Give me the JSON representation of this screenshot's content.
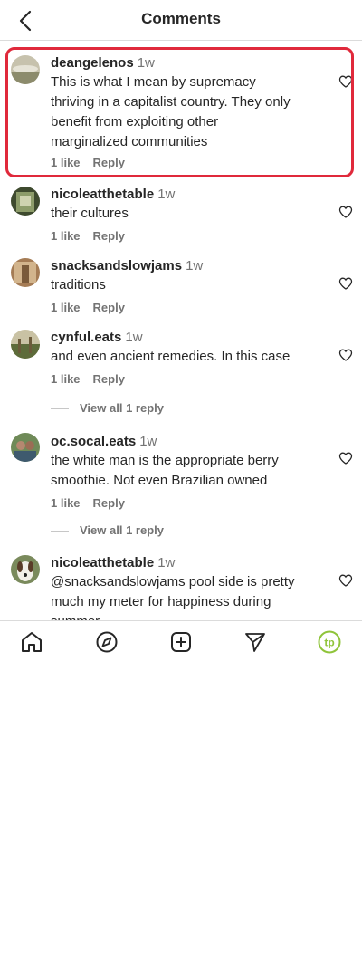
{
  "header": {
    "title": "Comments"
  },
  "comments": [
    {
      "username": "deangelenos",
      "time": "1w",
      "lines": [
        "This is what I mean by ​​supremacy",
        "thriving in a capitalist country. They only",
        "benefit from exploiting other",
        "marginalized communities"
      ],
      "likes": "1 like",
      "reply": "Reply"
    },
    {
      "username": "nicoleatthetable",
      "time": "1w",
      "lines": [
        "their cultures"
      ],
      "likes": "1 like",
      "reply": "Reply"
    },
    {
      "username": "snacksandslowjams",
      "time": "1w",
      "lines": [
        "traditions"
      ],
      "likes": "1 like",
      "reply": "Reply"
    },
    {
      "username": "cynful.eats",
      "time": "1w",
      "lines": [
        "and even ancient remedies. In this case"
      ],
      "likes": "1 like",
      "reply": "Reply",
      "view_replies": "View all 1 reply"
    },
    {
      "username": "oc.socal.eats",
      "time": "1w",
      "lines": [
        "the white man is the appropriate berry",
        "smoothie. Not even Brazilian owned"
      ],
      "likes": "1 like",
      "reply": "Reply",
      "view_replies": "View all 1 reply"
    },
    {
      "username": "nicoleatthetable",
      "time": "1w",
      "lines": [
        "@snacksandslowjams pool side is pretty",
        "much my meter for happiness during",
        "summer ​​"
      ]
    }
  ],
  "tabbar": {
    "items": [
      "home-icon",
      "explore-icon",
      "create-icon",
      "direct-messages-icon",
      "profile-avatar"
    ],
    "profile_initials": "tp",
    "profile_color": "#8fc43a"
  },
  "colors": {
    "highlight": "#e0293b",
    "secondary_text": "#737373",
    "divider": "#dbdbdb"
  }
}
